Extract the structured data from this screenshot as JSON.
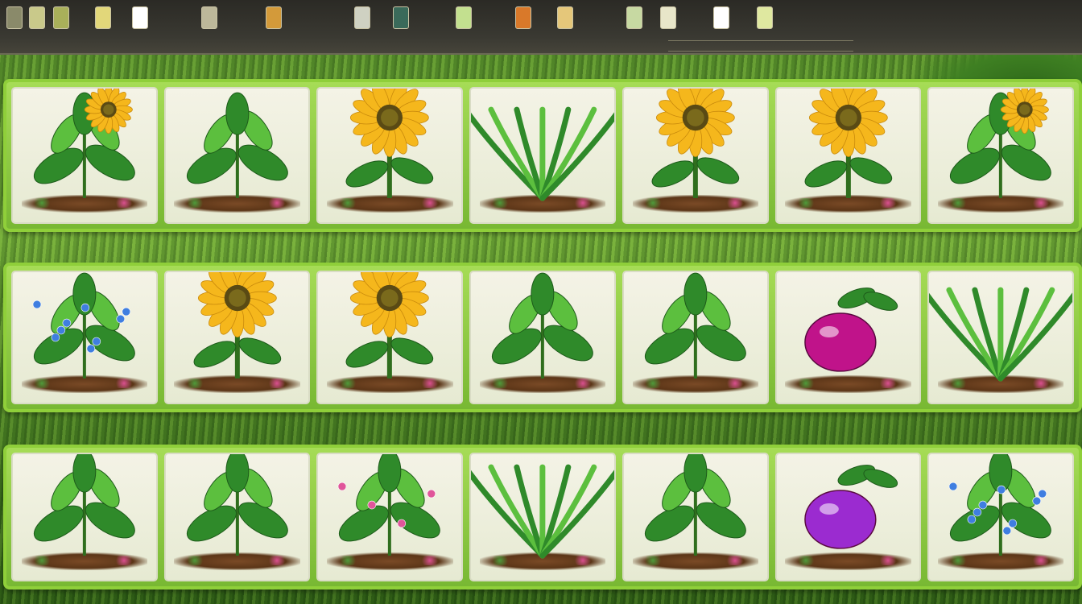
{
  "toolbar": {
    "tools": [
      {
        "name": "tool-1",
        "label": "",
        "color": "#8a8a6a"
      },
      {
        "name": "tool-2",
        "label": "",
        "color": "#c9c98a"
      },
      {
        "name": "tool-3",
        "label": "",
        "color": "#a9b05a"
      },
      {
        "name": "tool-4",
        "label": "",
        "color": "#e2d77a"
      },
      {
        "name": "tool-5",
        "label": "",
        "color": "#ffffff"
      },
      {
        "name": "tool-6",
        "label": "",
        "color": "#bdb89a"
      },
      {
        "name": "tool-7",
        "label": "",
        "color": "#d39a3a"
      },
      {
        "name": "tool-8",
        "label": "",
        "color": "#cfd1c2"
      },
      {
        "name": "tool-9",
        "label": "",
        "color": "#3a6a5a"
      },
      {
        "name": "tool-10",
        "label": "",
        "color": "#c3e08f"
      },
      {
        "name": "tool-11",
        "label": "",
        "color": "#d9792a"
      },
      {
        "name": "tool-12",
        "label": "",
        "color": "#e5c77a"
      },
      {
        "name": "tool-13",
        "label": "",
        "color": "#c7d9a2"
      },
      {
        "name": "tool-14",
        "label": "",
        "color": "#e8e6c9"
      },
      {
        "name": "tool-15",
        "label": "",
        "color": "#ffffff"
      },
      {
        "name": "tool-16",
        "label": "",
        "color": "#dfe8a0"
      }
    ]
  },
  "shelves": [
    {
      "name": "shelf-row-1",
      "slots": [
        {
          "plant": "bush-with-sunflower-icon",
          "kind": "bush",
          "flower": "sunflower"
        },
        {
          "plant": "leafy-plant-icon",
          "kind": "leafy",
          "flower": ""
        },
        {
          "plant": "sunflower-icon",
          "kind": "sunflower",
          "flower": "sunflower"
        },
        {
          "plant": "fern-icon",
          "kind": "fern",
          "flower": ""
        },
        {
          "plant": "sunflower-icon",
          "kind": "sunflower",
          "flower": "sunflower"
        },
        {
          "plant": "sunflower-icon",
          "kind": "sunflower",
          "flower": "sunflower"
        },
        {
          "plant": "sunflower-bush-icon",
          "kind": "bush",
          "flower": "sunflower"
        }
      ]
    },
    {
      "name": "shelf-row-2",
      "slots": [
        {
          "plant": "blue-flower-bush-icon",
          "kind": "bush",
          "flower": "blue"
        },
        {
          "plant": "sunflower-cluster-icon",
          "kind": "sunflower",
          "flower": "sunflower"
        },
        {
          "plant": "sunflower-icon",
          "kind": "sunflower",
          "flower": "sunflower"
        },
        {
          "plant": "leafy-plant-icon",
          "kind": "leafy",
          "flower": ""
        },
        {
          "plant": "leafy-plant-icon",
          "kind": "leafy",
          "flower": ""
        },
        {
          "plant": "magenta-fruit-icon",
          "kind": "fruit",
          "flower": "magenta"
        },
        {
          "plant": "grass-plant-icon",
          "kind": "fern",
          "flower": ""
        }
      ]
    },
    {
      "name": "shelf-row-3",
      "slots": [
        {
          "plant": "round-leafy-plant-icon",
          "kind": "leafy",
          "flower": ""
        },
        {
          "plant": "leafy-plant-icon",
          "kind": "leafy",
          "flower": ""
        },
        {
          "plant": "leafy-plant-with-buds-icon",
          "kind": "leafy",
          "flower": "pink"
        },
        {
          "plant": "fern-icon",
          "kind": "fern",
          "flower": ""
        },
        {
          "plant": "leafy-plant-icon",
          "kind": "leafy",
          "flower": ""
        },
        {
          "plant": "purple-fruit-icon",
          "kind": "fruit",
          "flower": "purple"
        },
        {
          "plant": "blue-flower-plant-icon",
          "kind": "bush",
          "flower": "blue"
        }
      ]
    }
  ],
  "colors": {
    "shelf_border": "#8fcf3a",
    "leaf": "#2f8a2a",
    "leaf_light": "#5cbf3e",
    "sunflower_petal": "#f5b71c",
    "sunflower_center": "#5a4a14",
    "blue_flower": "#3f7ee0",
    "magenta_fruit": "#c0138a",
    "purple_fruit": "#9b2bd0",
    "pink_flower": "#e0559a"
  }
}
